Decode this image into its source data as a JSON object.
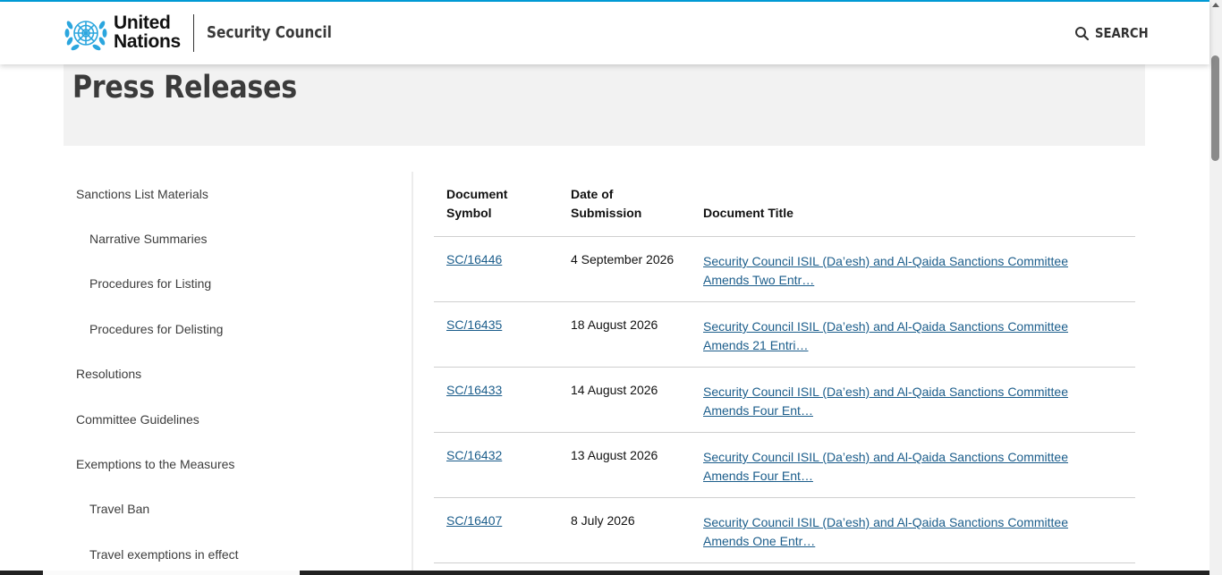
{
  "header": {
    "brand_line1": "United",
    "brand_line2": "Nations",
    "site_title": "Security Council",
    "search_label": "SEARCH",
    "search_icon": "magnifier-icon",
    "logo_icon": "un-emblem-icon"
  },
  "hero": {
    "title": "Press Releases"
  },
  "sidebar": {
    "items": [
      {
        "label": "Sanctions List Materials"
      },
      {
        "label": "Narrative Summaries"
      },
      {
        "label": "Procedures for Listing"
      },
      {
        "label": "Procedures for Delisting"
      },
      {
        "label": "Resolutions"
      },
      {
        "label": "Committee Guidelines"
      },
      {
        "label": "Exemptions to the Measures"
      },
      {
        "label": "Travel Ban"
      },
      {
        "label": "Travel exemptions in effect"
      }
    ]
  },
  "table": {
    "headers": {
      "symbol_line1": "Document",
      "symbol_line2": "Symbol",
      "date_line1": "Date of",
      "date_line2": "Submission",
      "title": "Document Title"
    },
    "rows": [
      {
        "symbol": "SC/16446",
        "date": "4 September 2026",
        "title_line1": "Security Council ISIL (Da’esh) and Al-Qaida Sanctions Committee",
        "title_line2": "Amends Two Entr…"
      },
      {
        "symbol": "SC/16435",
        "date": "18 August 2026",
        "title_line1": "Security Council ISIL (Da’esh) and Al-Qaida Sanctions Committee",
        "title_line2": "Amends 21 Entri…"
      },
      {
        "symbol": "SC/16433",
        "date": "14 August 2026",
        "title_line1": "Security Council ISIL (Da’esh) and Al-Qaida Sanctions Committee",
        "title_line2": "Amends Four Ent…"
      },
      {
        "symbol": "SC/16432",
        "date": "13 August 2026",
        "title_line1": "Security Council ISIL (Da’esh) and Al-Qaida Sanctions Committee",
        "title_line2": "Amends Four Ent…"
      },
      {
        "symbol": "SC/16407",
        "date": "8 July 2026",
        "title_line1": "Security Council ISIL (Da’esh) and Al-Qaida Sanctions Committee",
        "title_line2": "Amends One Entr…"
      }
    ]
  },
  "colors": {
    "accent": "#009edb",
    "link": "#1b5d8b",
    "un_blue": "#2ba6de",
    "hero_bg": "#f2f2f2"
  }
}
